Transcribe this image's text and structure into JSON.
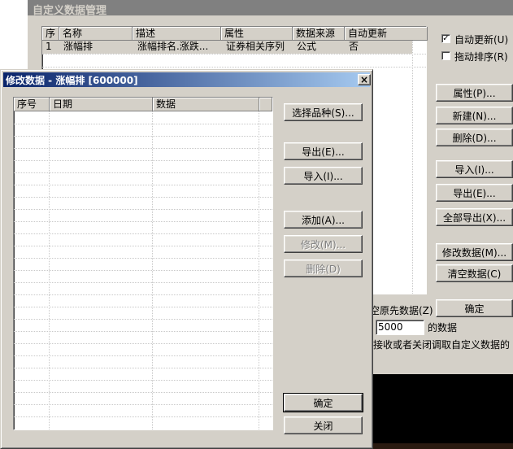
{
  "main_window": {
    "title": "自定义数据管理",
    "columns": [
      "序",
      "名称",
      "描述",
      "属性",
      "数据来源",
      "自动更新"
    ],
    "rows": [
      {
        "idx": "1",
        "name": "涨幅排",
        "desc": "涨幅排名.涨跌...",
        "attr": "证券相关序列",
        "source": "公式",
        "auto": "否"
      }
    ],
    "auto_update_label": "自动更新(U)",
    "auto_update_checked": "✓",
    "drag_sort_label": "拖动排序(R)",
    "buttons": {
      "properties": "属性(P)...",
      "new": "新建(N)...",
      "delete": "删除(D)...",
      "import": "导入(I)...",
      "export": "导出(E)...",
      "export_all": "全部导出(X)...",
      "modify_data": "修改数据(M)...",
      "clear_data": "清空数据(C)",
      "ok": "确定"
    },
    "clear_prev_label": "空原先数据(Z)",
    "keep_value": "5000",
    "keep_suffix": "的数据",
    "note_text": "接收或者关闭调取自定义数据的"
  },
  "dialog": {
    "title": "修改数据 - 涨幅排 [600000]",
    "close_glyph": "×",
    "columns": [
      "序号",
      "日期",
      "数据"
    ],
    "buttons": {
      "select": "选择品种(S)...",
      "export": "导出(E)...",
      "import": "导入(I)...",
      "add": "添加(A)...",
      "modify": "修改(M)...",
      "delete": "删除(D)",
      "ok": "确定",
      "close": "关闭"
    }
  },
  "colors": {
    "title_active_start": "#0a246a",
    "title_active_end": "#a6caf0",
    "title_inactive": "#808080",
    "face": "#d4d0c8",
    "selection": "#d4d0c8"
  }
}
